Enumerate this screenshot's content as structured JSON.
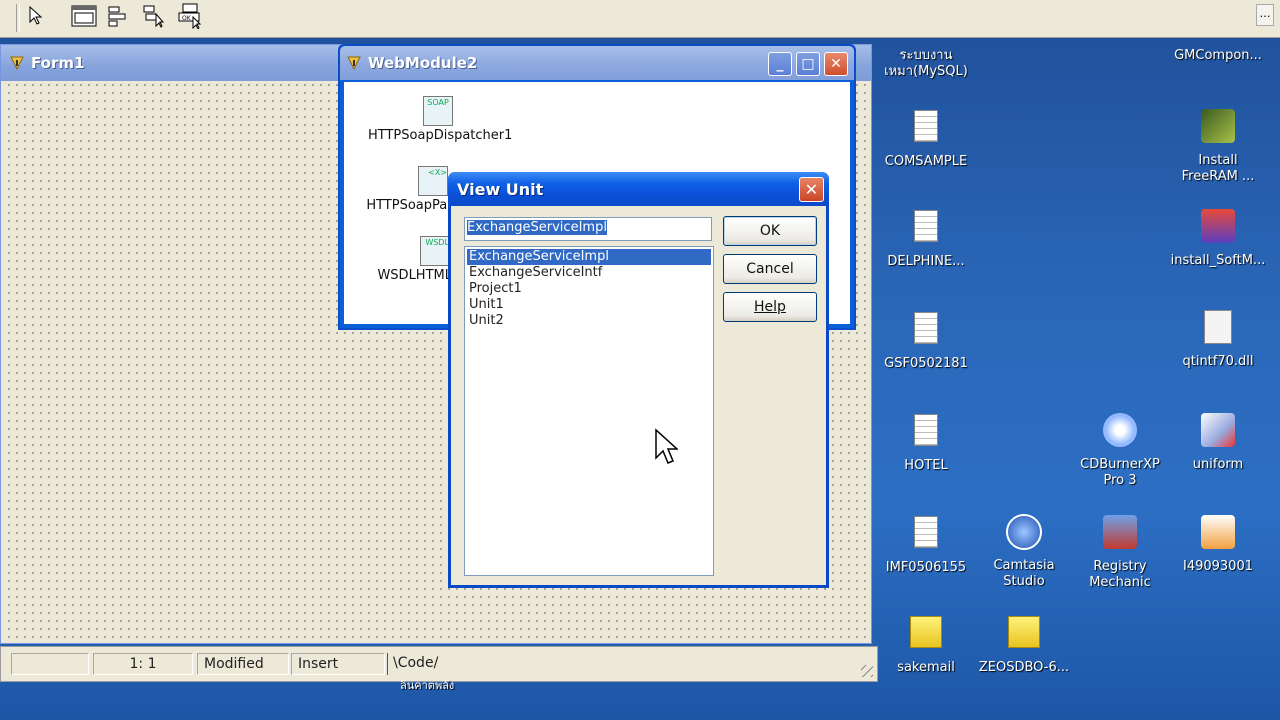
{
  "forms": {
    "form1_title": "Form1",
    "webmodule_title": "WebModule2",
    "components": [
      {
        "label": "HTTPSoapDispatcher1",
        "icon_text": "SOAP"
      },
      {
        "label": "HTTPSoapPas",
        "icon_text": "<X>"
      },
      {
        "label": "WSDLHTML",
        "icon_text": "WSDL"
      }
    ]
  },
  "dialog": {
    "title": "View Unit",
    "input_value": "ExchangeServiceImpl",
    "units": [
      "ExchangeServiceImpl",
      "ExchangeServiceIntf",
      "Project1",
      "Unit1",
      "Unit2"
    ],
    "selected_index": 0,
    "ok_label": "OK",
    "cancel_label": "Cancel",
    "help_label": "Help"
  },
  "editor_status": {
    "position": "1:   1",
    "modified": "Modified",
    "mode": "Insert",
    "code_tab": "Code"
  },
  "desktop": {
    "icons": [
      {
        "label": "ระบบงาน\nเหมา(MySQL)",
        "type": "none"
      },
      {
        "label": "GMCompon...",
        "type": "none"
      },
      {
        "label": "COMSAMPLE",
        "type": "notepad"
      },
      {
        "label": "Install\nFreeRAM ...",
        "type": "chip"
      },
      {
        "label": "DELPHINE...",
        "type": "notepad"
      },
      {
        "label": "install_SoftM...",
        "type": "installer"
      },
      {
        "label": "GSF0502181",
        "type": "notepad"
      },
      {
        "label": "qtintf70.dll",
        "type": "dll"
      },
      {
        "label": "HOTEL",
        "type": "notepad"
      },
      {
        "label": "CDBurnerXP\nPro 3",
        "type": "cd"
      },
      {
        "label": "uniform",
        "type": "paint"
      },
      {
        "label": "IMF0506155",
        "type": "notepad"
      },
      {
        "label": "Camtasia\nStudio",
        "type": "camtasia"
      },
      {
        "label": "Registry\nMechanic",
        "type": "registry"
      },
      {
        "label": "I49093001",
        "type": "image"
      },
      {
        "label": "sakemail",
        "type": "zip"
      },
      {
        "label": "ZEOSDBO-6...",
        "type": "zip"
      }
    ]
  },
  "taskbar": {
    "label": "ลินคาตพลัง"
  },
  "colors": {
    "selection": "#316ac5",
    "dialog_title": "#0a4fd6",
    "desktop": "#2a66b7"
  }
}
